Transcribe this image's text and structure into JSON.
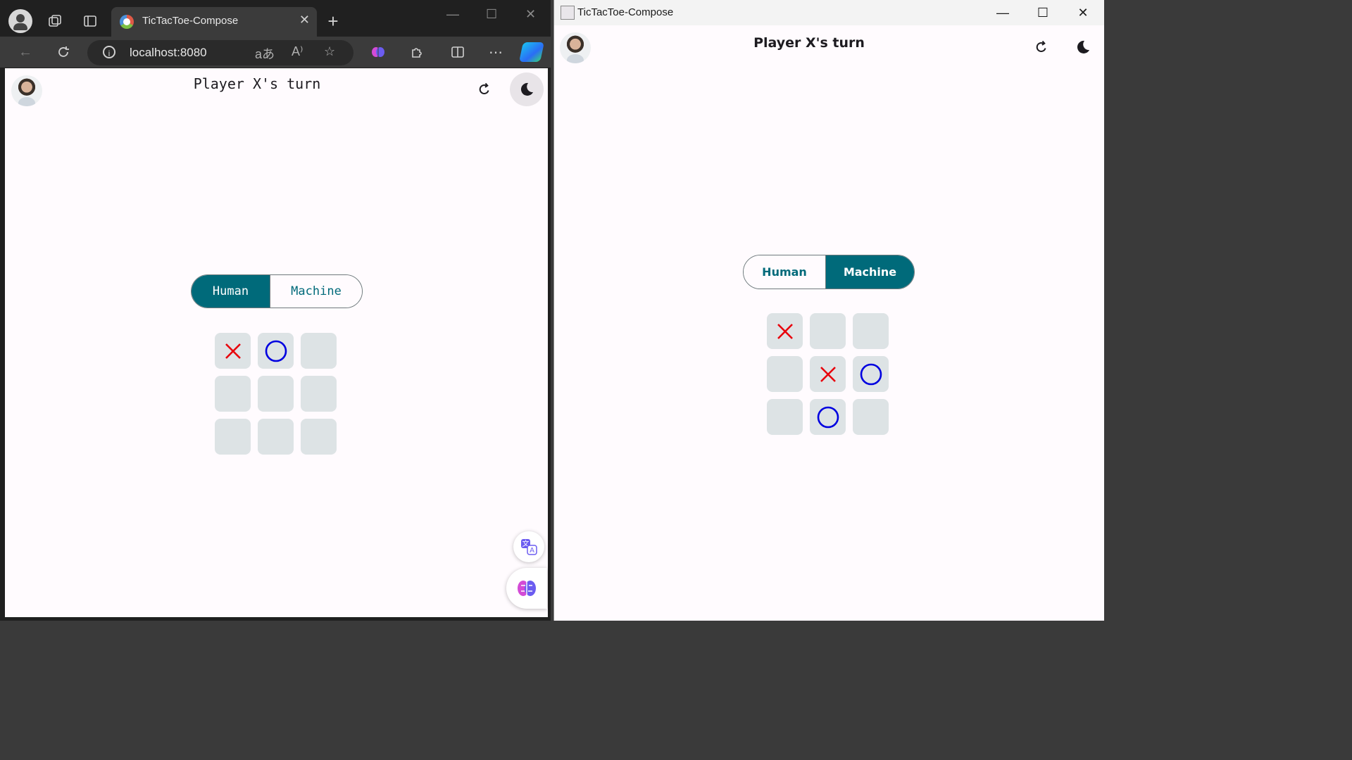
{
  "browser": {
    "tab_title": "TicTacToe-Compose",
    "url": "localhost:8080",
    "app": {
      "status": "Player X's turn",
      "mode_options": [
        "Human",
        "Machine"
      ],
      "selected_mode": "Human",
      "board": [
        "X",
        "O",
        "",
        "",
        "",
        "",
        "",
        "",
        ""
      ]
    },
    "icons": [
      "profile-icon",
      "workspaces-icon",
      "tab-actions-icon",
      "site-favicon",
      "close-tab-icon",
      "new-tab-icon",
      "minimize-icon",
      "maximize-icon",
      "close-window-icon",
      "back-icon",
      "refresh-icon",
      "site-info-icon",
      "translate-icon",
      "read-aloud-icon",
      "favorite-star-icon",
      "brain-extension-icon",
      "extensions-icon",
      "split-screen-icon",
      "more-icon",
      "copilot-icon"
    ]
  },
  "desktop": {
    "window_title": "TicTacToe-Compose",
    "app": {
      "status": "Player X's turn",
      "mode_options": [
        "Human",
        "Machine"
      ],
      "selected_mode": "Machine",
      "board": [
        "X",
        "",
        "",
        "",
        "X",
        "O",
        "",
        "O",
        ""
      ]
    }
  },
  "colors": {
    "accent": "#006a7a",
    "x_mark": "#e8000b",
    "o_mark": "#0000e0",
    "cell_bg": "#dde3e5",
    "surface": "#fffbfe"
  }
}
